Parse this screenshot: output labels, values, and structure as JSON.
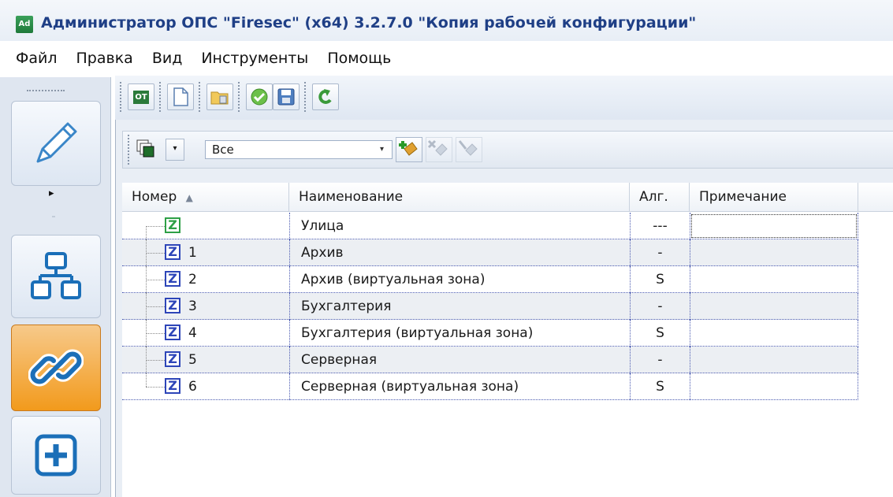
{
  "window": {
    "logo_text": "Ad",
    "title": "Администратор ОПС \"Firesec\"  (x64) 3.2.7.0  \"Копия рабочей конфигурации\""
  },
  "menu": [
    "Файл",
    "Правка",
    "Вид",
    "Инструменты",
    "Помощь"
  ],
  "nav": {
    "items": [
      {
        "icon": "pencil-icon"
      },
      {
        "icon": "network-icon"
      },
      {
        "icon": "link-icon",
        "active": true
      },
      {
        "icon": "add-icon"
      }
    ]
  },
  "main_toolbar": {
    "buttons": [
      "ot-icon",
      "new-document-icon",
      "open-folder-icon",
      "check-icon",
      "save-icon",
      "refresh-icon"
    ],
    "ot_label": "OT"
  },
  "filter": {
    "value": "Все"
  },
  "grid": {
    "columns": [
      "Номер",
      "Наименование",
      "Алг.",
      "Примечание"
    ],
    "rows": [
      {
        "number": "",
        "name": "Улица",
        "alg": "---",
        "note": "",
        "icon": "green"
      },
      {
        "number": "1",
        "name": "Архив",
        "alg": "-",
        "note": ""
      },
      {
        "number": "2",
        "name": "Архив (виртуальная зона)",
        "alg": "S",
        "note": ""
      },
      {
        "number": "3",
        "name": "Бухгалтерия",
        "alg": "-",
        "note": ""
      },
      {
        "number": "4",
        "name": "Бухгалтерия (виртуальная зона)",
        "alg": "S",
        "note": ""
      },
      {
        "number": "5",
        "name": "Серверная",
        "alg": "-",
        "note": ""
      },
      {
        "number": "6",
        "name": "Серверная (виртуальная зона)",
        "alg": "S",
        "note": ""
      }
    ]
  },
  "colors": {
    "title": "#1f3f86",
    "accent_orange": "#f29a1c",
    "zone_blue": "#2d45b8",
    "zone_green": "#2ea046"
  }
}
